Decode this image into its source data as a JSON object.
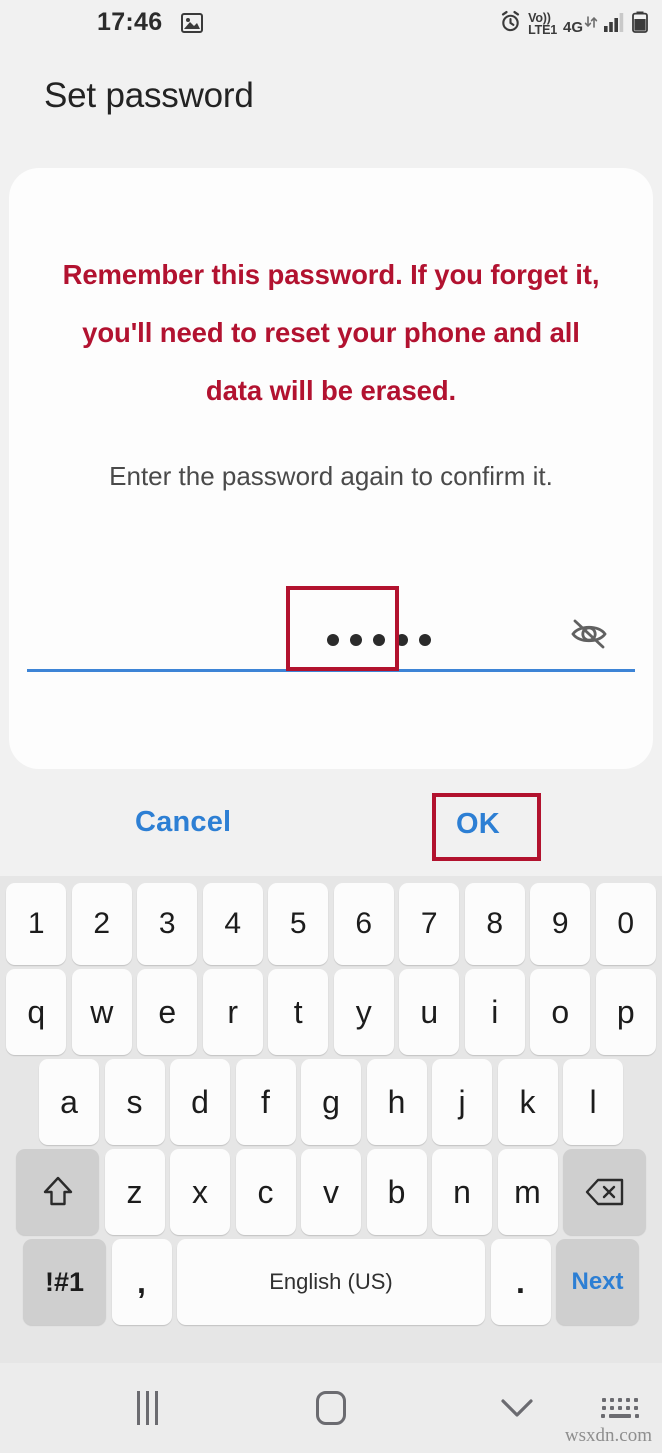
{
  "status_bar": {
    "clock": "17:46",
    "icons": {
      "gallery": "image-icon",
      "alarm": "alarm-clock-icon",
      "volte_line1": "Vo))",
      "volte_line2": "LTE1",
      "network": "4G",
      "data_arrows": "data-transfer-icon",
      "signal": "signal-bars-icon",
      "battery": "battery-icon"
    }
  },
  "header": {
    "title": "Set password"
  },
  "dialog": {
    "warning": "Remember this password. If you forget it, you'll need to reset your phone and all data will be erased.",
    "instruction": "Enter the password again to confirm it.",
    "password_field": {
      "name": "confirm-password-field",
      "value": "•••••",
      "char_count": 5,
      "masked": true,
      "toggle_icon": "eye-off-icon",
      "underline_color": "#3d84d6"
    },
    "buttons": {
      "cancel": "Cancel",
      "ok": "OK"
    }
  },
  "annotations": {
    "color": "#b2122e",
    "boxes": [
      "password-field-highlight",
      "ok-button-highlight"
    ]
  },
  "keyboard": {
    "rows": {
      "numbers": [
        "1",
        "2",
        "3",
        "4",
        "5",
        "6",
        "7",
        "8",
        "9",
        "0"
      ],
      "top": [
        "q",
        "w",
        "e",
        "r",
        "t",
        "y",
        "u",
        "i",
        "o",
        "p"
      ],
      "home": [
        "a",
        "s",
        "d",
        "f",
        "g",
        "h",
        "j",
        "k",
        "l"
      ],
      "bottom_letters": [
        "z",
        "x",
        "c",
        "v",
        "b",
        "n",
        "m"
      ]
    },
    "shift_icon": "shift-arrow-icon",
    "backspace_icon": "backspace-icon",
    "symbols_key": "!#1",
    "comma_key": ",",
    "space_key": "English (US)",
    "period_key": ".",
    "next_key": "Next"
  },
  "nav_bar": {
    "recents": "recents-icon",
    "home": "home-icon",
    "hide_keyboard": "chevron-down-icon",
    "keyboard_switch": "keyboard-switcher-icon"
  },
  "watermark": "wsxdn.com",
  "colors": {
    "background": "#f1f1f1",
    "card": "#fdfdfd",
    "warning_red": "#b21230",
    "link_blue": "#2d7fd4",
    "annotation_red": "#b2122e",
    "keyboard_bg": "#e6e6e6"
  }
}
